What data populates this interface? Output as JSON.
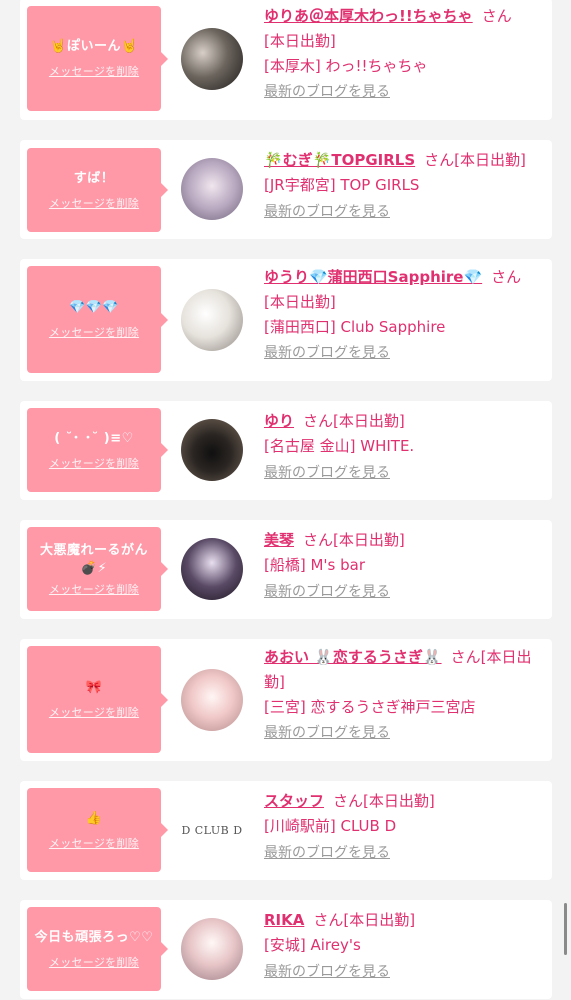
{
  "colors": {
    "accent": "#e0306f",
    "bubble": "#ff99a8",
    "muted": "#9a9a9a",
    "background": "#f3f3f3"
  },
  "items": [
    {
      "bubble_text": "🤘ぽいーん🤘",
      "delete_label": "メッセージを削除",
      "name": "ゆりあ＠本厚木わっ!!ちゃちゃ",
      "san": "さん",
      "status": "[本日出勤]",
      "shop": "[本厚木] わっ!!ちゃちゃ",
      "blog_link": "最新のブログを見る"
    },
    {
      "bubble_text": "すば！",
      "delete_label": "メッセージを削除",
      "name": "🎋むぎ🎋TOPGIRLS",
      "san": "さん",
      "status": "[本日出勤]",
      "shop": "[JR宇都宮] TOP GIRLS",
      "blog_link": "最新のブログを見る"
    },
    {
      "bubble_text": "💎💎💎",
      "delete_label": "メッセージを削除",
      "name": "ゆうり💎蒲田西口Sapphire💎",
      "san": "さん",
      "status": "[本日出勤]",
      "shop": "[蒲田西口] Club Sapphire",
      "blog_link": "最新のブログを見る"
    },
    {
      "bubble_text": "( ˘･ ･˘ )≡♡",
      "delete_label": "メッセージを削除",
      "name": "ゆり",
      "san": "さん",
      "status": "[本日出勤]",
      "shop": "[名古屋 金山] WHITE.",
      "blog_link": "最新のブログを見る"
    },
    {
      "bubble_text": "大悪魔れーるがん",
      "bubble_text2": "💣⚡",
      "delete_label": "メッセージを削除",
      "name": "美琴",
      "san": "さん",
      "status": "[本日出勤]",
      "shop": "[船橋] M's bar",
      "blog_link": "最新のブログを見る"
    },
    {
      "bubble_text": "🎀",
      "delete_label": "メッセージを削除",
      "name": "あおい 🐰恋するうさぎ🐰",
      "san": "さん",
      "status": "[本日出勤]",
      "shop": "[三宮] 恋するうさぎ神戸三宮店",
      "blog_link": "最新のブログを見る"
    },
    {
      "bubble_text": "👍",
      "delete_label": "メッセージを削除",
      "name": "スタッフ",
      "san": "さん",
      "status": "[本日出勤]",
      "shop": "[川崎駅前] CLUB D",
      "blog_link": "最新のブログを見る",
      "avatar_logo": "D CLUB D"
    },
    {
      "bubble_text": "今日も頑張ろっ♡♡",
      "delete_label": "メッセージを削除",
      "name": "RIKA",
      "san": "さん",
      "status": "[本日出勤]",
      "shop": "[安城] Airey's",
      "blog_link": "最新のブログを見る"
    }
  ]
}
